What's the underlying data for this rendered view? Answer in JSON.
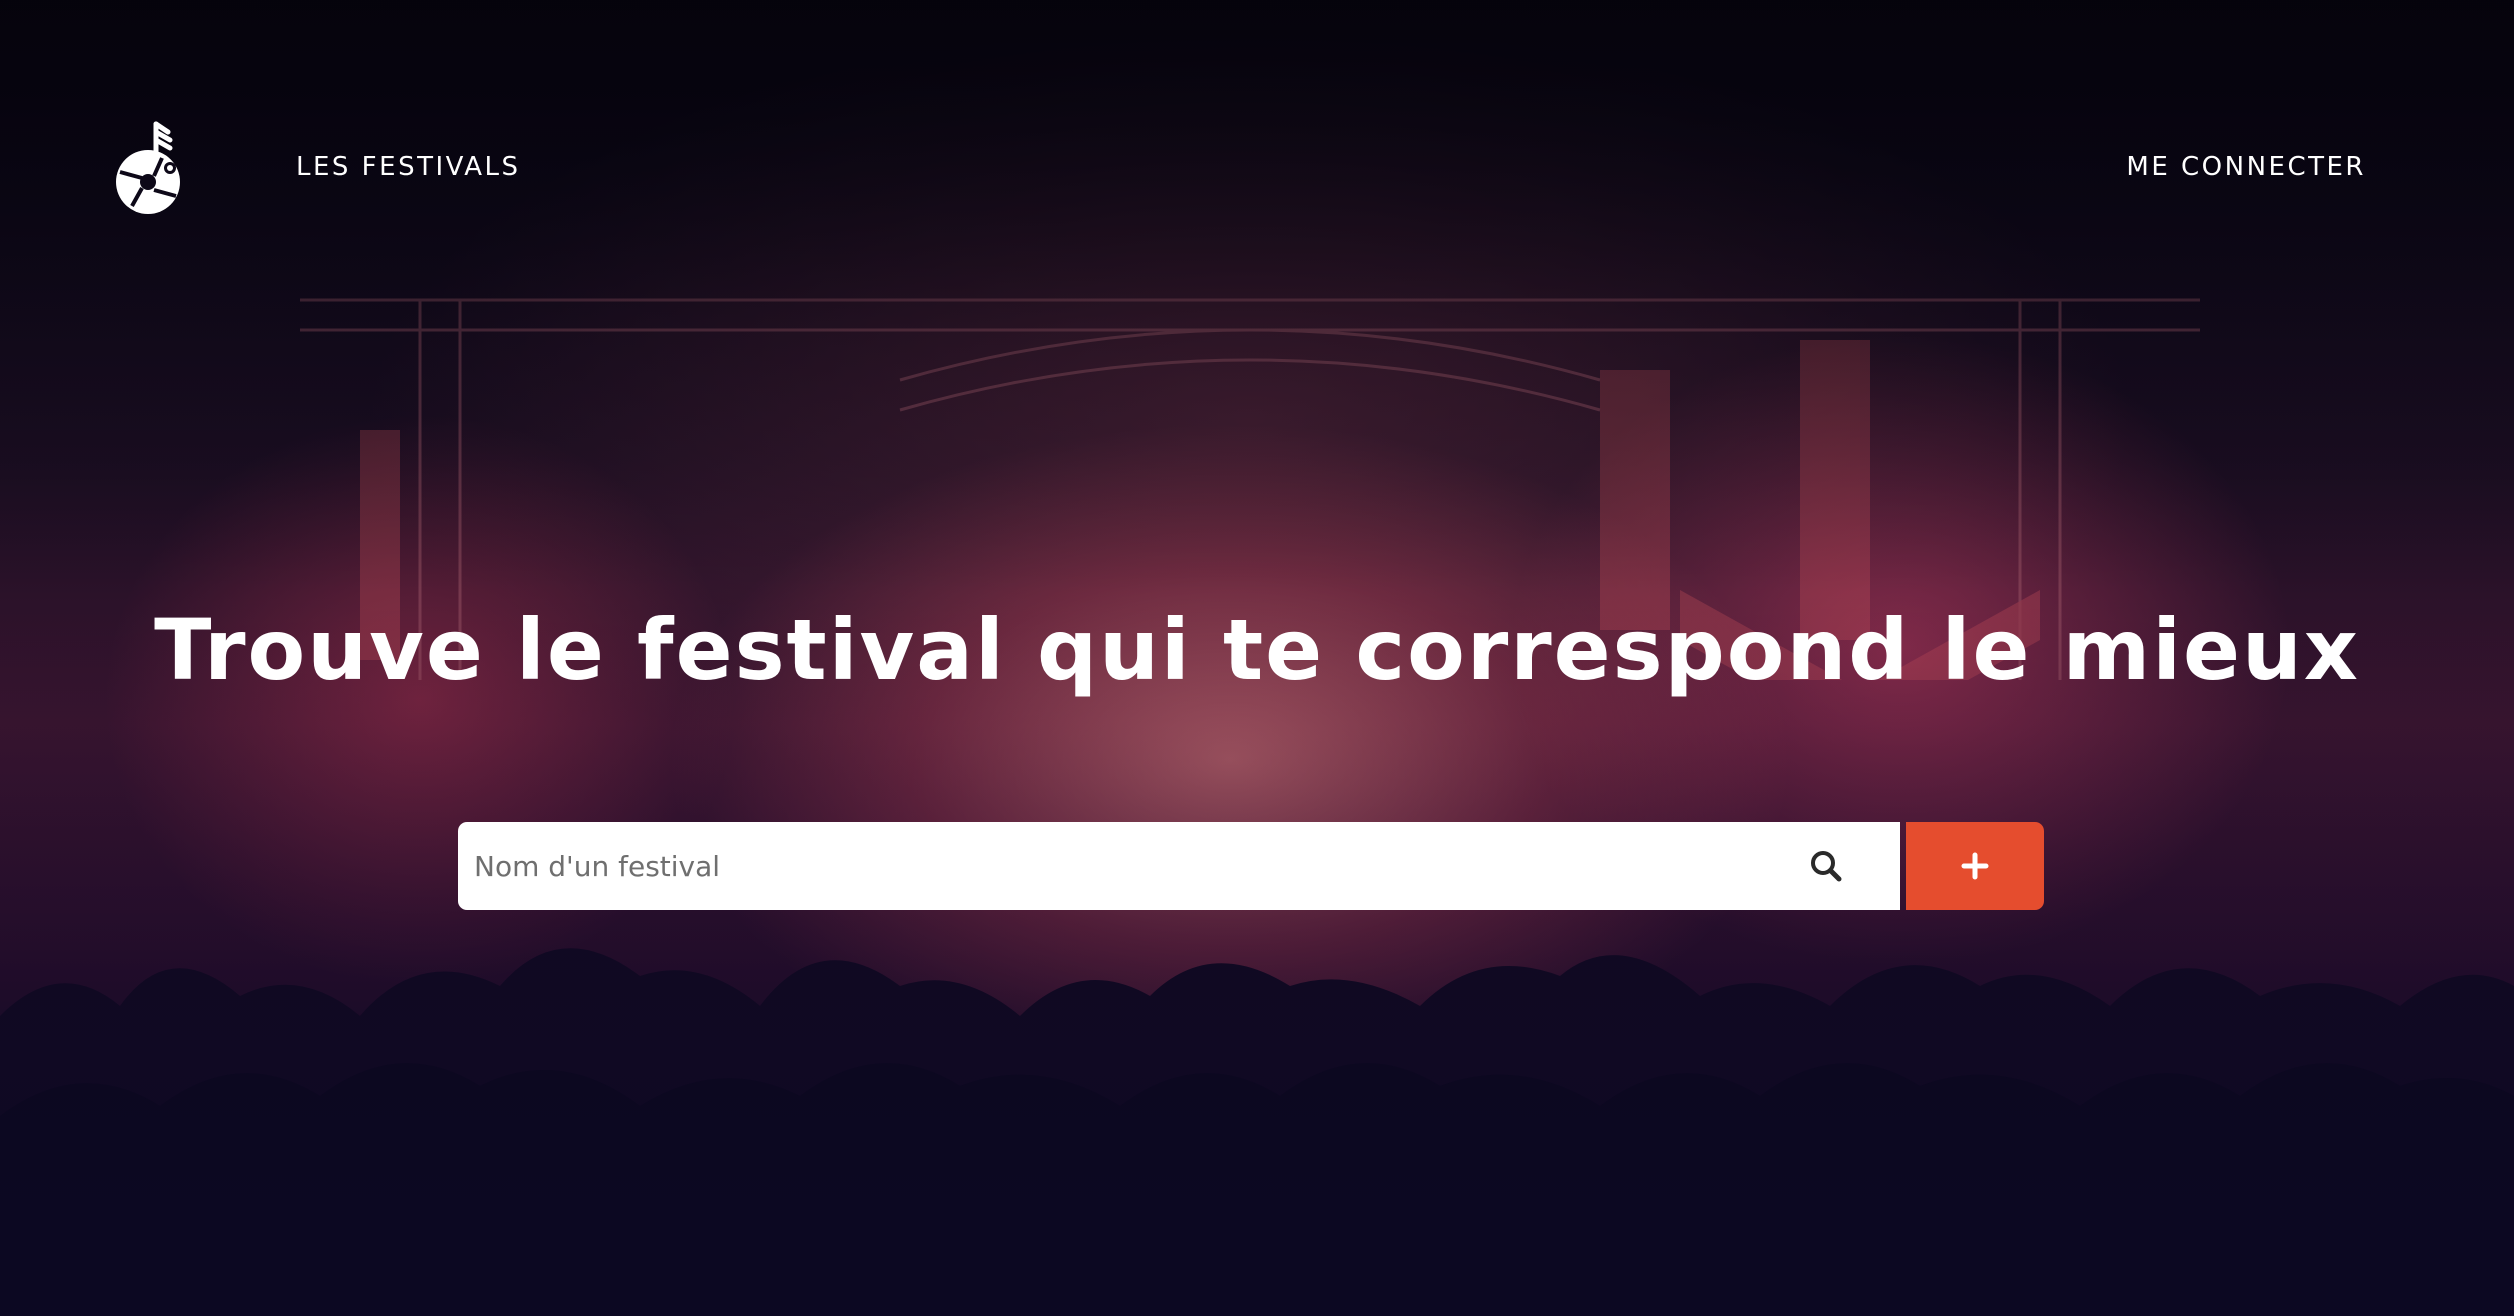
{
  "nav": {
    "festivals_label": "LES FESTIVALS",
    "login_label": "ME CONNECTER"
  },
  "hero": {
    "headline": "Trouve le festival qui te correspond le mieux"
  },
  "search": {
    "placeholder": "Nom d'un festival",
    "value": ""
  },
  "icons": {
    "logo": "music-note-disc-logo",
    "search": "search-icon",
    "add": "plus-icon"
  },
  "colors": {
    "accent": "#e54d2e",
    "nav_text": "#ffffff",
    "search_background": "#ffffff"
  }
}
